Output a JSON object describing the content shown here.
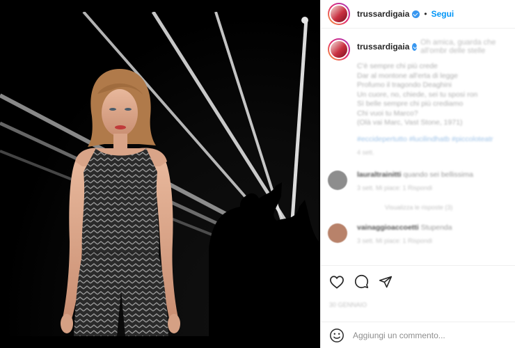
{
  "post": {
    "username": "trussardigaia",
    "follow_label": "Segui",
    "separator": "•"
  },
  "caption": {
    "username": "trussardigaia",
    "lines": [
      "Oh amica, guarda che all'ombr delle stelle",
      "C'è sempre chi più crede",
      "Dar al montone all'erta di legge",
      "Profumo il tragondo Deaghini",
      "Un cuore, no, chiede, sei tu sposi ron",
      "Sì belle sempre chi più crediamo",
      "Chi vuoi tu Marco?",
      "(Olà vai Marc, Vast Stone, 1971)"
    ],
    "hashtags": "#eccidepertutto #lucilindhatb #piccoloteatr",
    "time": "4 sett."
  },
  "comments": [
    {
      "username": "lauraltrainitti",
      "text": "quando sei bellissima",
      "meta": "3 sett.   Mi piace: 1   Rispondi",
      "avatar_color": "#8d8d8d"
    },
    {
      "username": "vainaggioaccoetti",
      "text": "Stupenda",
      "meta": "3 sett.   Mi piace: 1   Rispondi",
      "avatar_color": "#b8826a"
    }
  ],
  "replies_label": "Visualizza le risposte (3)",
  "date_label": "30 GENNAIO",
  "add_comment_placeholder": "Aggiungi un commento...",
  "icons": [
    "heart-icon",
    "comment-icon",
    "share-icon",
    "emoji-icon"
  ],
  "colors": {
    "accent": "#0095f6",
    "verified": "#3897f0",
    "background": "#ffffff",
    "photo_bg": "#000000"
  }
}
